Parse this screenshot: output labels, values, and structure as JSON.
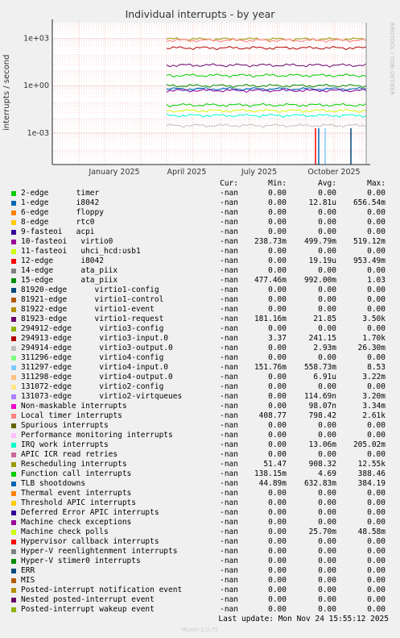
{
  "chart_data": {
    "type": "line",
    "title": "Individual interrupts - by year",
    "ylabel": "interrupts / second",
    "yscale": "log",
    "ytick_labels": [
      "1e+03",
      "1e+00",
      "1e-03"
    ],
    "xtick_labels": [
      "January 2025",
      "April 2025",
      "July 2025",
      "October 2025"
    ],
    "grid": true,
    "side_label": "RRDTOOL / TOBI OETIKER",
    "columns": [
      "Cur:",
      "Min:",
      "Avg:",
      "Max:"
    ],
    "series": [
      {
        "name": "2-edge      timer",
        "color": "#00cc00",
        "cur": "-nan",
        "min": "0.00",
        "avg": "0.00",
        "max": "0.00"
      },
      {
        "name": "1-edge      i8042",
        "color": "#0066b3",
        "cur": "-nan",
        "min": "0.00",
        "avg": "12.81u",
        "max": "656.54m"
      },
      {
        "name": "6-edge      floppy",
        "color": "#ff8000",
        "cur": "-nan",
        "min": "0.00",
        "avg": "0.00",
        "max": "0.00"
      },
      {
        "name": "8-edge      rtc0",
        "color": "#ffcc00",
        "cur": "-nan",
        "min": "0.00",
        "avg": "0.00",
        "max": "0.00"
      },
      {
        "name": "9-fasteoi   acpi",
        "color": "#330099",
        "cur": "-nan",
        "min": "0.00",
        "avg": "0.00",
        "max": "0.00"
      },
      {
        "name": "10-fasteoi   virtio0",
        "color": "#990099",
        "cur": "-nan",
        "min": "238.73m",
        "avg": "499.79m",
        "max": "519.12m"
      },
      {
        "name": "11-fasteoi   uhci_hcd:usb1",
        "color": "#ccff00",
        "cur": "-nan",
        "min": "0.00",
        "avg": "0.00",
        "max": "0.00"
      },
      {
        "name": "12-edge      i8042",
        "color": "#ff0000",
        "cur": "-nan",
        "min": "0.00",
        "avg": "19.19u",
        "max": "953.49m"
      },
      {
        "name": "14-edge      ata_piix",
        "color": "#808080",
        "cur": "-nan",
        "min": "0.00",
        "avg": "0.00",
        "max": "0.00"
      },
      {
        "name": "15-edge      ata_piix",
        "color": "#008f00",
        "cur": "-nan",
        "min": "477.46m",
        "avg": "992.00m",
        "max": "1.03"
      },
      {
        "name": "81920-edge      virtio1-config",
        "color": "#00487d",
        "cur": "-nan",
        "min": "0.00",
        "avg": "0.00",
        "max": "0.00"
      },
      {
        "name": "81921-edge      virtio1-control",
        "color": "#b35a00",
        "cur": "-nan",
        "min": "0.00",
        "avg": "0.00",
        "max": "0.00"
      },
      {
        "name": "81922-edge      virtio1-event",
        "color": "#b38f00",
        "cur": "-nan",
        "min": "0.00",
        "avg": "0.00",
        "max": "0.00"
      },
      {
        "name": "81923-edge      virtio1-request",
        "color": "#6b006b",
        "cur": "-nan",
        "min": "181.16m",
        "avg": "21.85",
        "max": "3.50k"
      },
      {
        "name": "294912-edge      virtio3-config",
        "color": "#8fb300",
        "cur": "-nan",
        "min": "0.00",
        "avg": "0.00",
        "max": "0.00"
      },
      {
        "name": "294913-edge      virtio3-input.0",
        "color": "#b30000",
        "cur": "-nan",
        "min": "3.37",
        "avg": "241.15",
        "max": "1.70k"
      },
      {
        "name": "294914-edge      virtio3-output.0",
        "color": "#bebebe",
        "cur": "-nan",
        "min": "0.00",
        "avg": "2.93m",
        "max": "26.30m"
      },
      {
        "name": "311296-edge      virtio4-config",
        "color": "#80ff80",
        "cur": "-nan",
        "min": "0.00",
        "avg": "0.00",
        "max": "0.00"
      },
      {
        "name": "311297-edge      virtio4-input.0",
        "color": "#80c9ff",
        "cur": "-nan",
        "min": "151.76m",
        "avg": "558.73m",
        "max": "8.53"
      },
      {
        "name": "311298-edge      virtio4-output.0",
        "color": "#ffc080",
        "cur": "-nan",
        "min": "0.00",
        "avg": "6.91u",
        "max": "3.22m"
      },
      {
        "name": "131072-edge      virtio2-config",
        "color": "#ffe680",
        "cur": "-nan",
        "min": "0.00",
        "avg": "0.00",
        "max": "0.00"
      },
      {
        "name": "131073-edge      virtio2-virtqueues",
        "color": "#aa80ff",
        "cur": "-nan",
        "min": "0.00",
        "avg": "114.69n",
        "max": "3.20m"
      },
      {
        "name": "Non-maskable interrupts",
        "color": "#ee00cc",
        "cur": "-nan",
        "min": "0.00",
        "avg": "98.07n",
        "max": "3.34m"
      },
      {
        "name": "Local timer interrupts",
        "color": "#ff8080",
        "cur": "-nan",
        "min": "408.77",
        "avg": "798.42",
        "max": "2.61k"
      },
      {
        "name": "Spurious interrupts",
        "color": "#666600",
        "cur": "-nan",
        "min": "0.00",
        "avg": "0.00",
        "max": "0.00"
      },
      {
        "name": "Performance monitoring interrupts",
        "color": "#ffbfff",
        "cur": "-nan",
        "min": "0.00",
        "avg": "0.00",
        "max": "0.00"
      },
      {
        "name": "IRQ work interrupts",
        "color": "#00ffcc",
        "cur": "-nan",
        "min": "0.00",
        "avg": "13.06m",
        "max": "205.02m"
      },
      {
        "name": "APIC ICR read retries",
        "color": "#cc6699",
        "cur": "-nan",
        "min": "0.00",
        "avg": "0.00",
        "max": "0.00"
      },
      {
        "name": "Rescheduling interrupts",
        "color": "#999900",
        "cur": "-nan",
        "min": "51.47",
        "avg": "908.32",
        "max": "12.55k"
      },
      {
        "name": "Function call interrupts",
        "color": "#00cc00",
        "cur": "-nan",
        "min": "138.15m",
        "avg": "4.69",
        "max": "388.46"
      },
      {
        "name": "TLB shootdowns",
        "color": "#0066b3",
        "cur": "-nan",
        "min": "44.89m",
        "avg": "632.83m",
        "max": "384.19"
      },
      {
        "name": "Thermal event interrupts",
        "color": "#ff8000",
        "cur": "-nan",
        "min": "0.00",
        "avg": "0.00",
        "max": "0.00"
      },
      {
        "name": "Threshold APIC interrupts",
        "color": "#ffcc00",
        "cur": "-nan",
        "min": "0.00",
        "avg": "0.00",
        "max": "0.00"
      },
      {
        "name": "Deferred Error APIC interrupts",
        "color": "#330099",
        "cur": "-nan",
        "min": "0.00",
        "avg": "0.00",
        "max": "0.00"
      },
      {
        "name": "Machine check exceptions",
        "color": "#990099",
        "cur": "-nan",
        "min": "0.00",
        "avg": "0.00",
        "max": "0.00"
      },
      {
        "name": "Machine check polls",
        "color": "#ccff00",
        "cur": "-nan",
        "min": "0.00",
        "avg": "25.70m",
        "max": "48.58m"
      },
      {
        "name": "Hypervisor callback interrupts",
        "color": "#ff0000",
        "cur": "-nan",
        "min": "0.00",
        "avg": "0.00",
        "max": "0.00"
      },
      {
        "name": "Hyper-V reenlightenment interrupts",
        "color": "#808080",
        "cur": "-nan",
        "min": "0.00",
        "avg": "0.00",
        "max": "0.00"
      },
      {
        "name": "Hyper-V stimer0 interrupts",
        "color": "#008f00",
        "cur": "-nan",
        "min": "0.00",
        "avg": "0.00",
        "max": "0.00"
      },
      {
        "name": "ERR",
        "color": "#00487d",
        "cur": "-nan",
        "min": "0.00",
        "avg": "0.00",
        "max": "0.00"
      },
      {
        "name": "MIS",
        "color": "#b35a00",
        "cur": "-nan",
        "min": "0.00",
        "avg": "0.00",
        "max": "0.00"
      },
      {
        "name": "Posted-interrupt notification event",
        "color": "#b38f00",
        "cur": "-nan",
        "min": "0.00",
        "avg": "0.00",
        "max": "0.00"
      },
      {
        "name": "Nested posted-interrupt event",
        "color": "#6b006b",
        "cur": "-nan",
        "min": "0.00",
        "avg": "0.00",
        "max": "0.00"
      },
      {
        "name": "Posted-interrupt wakeup event",
        "color": "#8fb300",
        "cur": "-nan",
        "min": "0.00",
        "avg": "0.00",
        "max": "0.00"
      }
    ],
    "plot_lines": [
      {
        "color": "#999900",
        "value": 900
      },
      {
        "color": "#b30000",
        "value": 250
      },
      {
        "color": "#ff8080",
        "value": 750
      },
      {
        "color": "#6b006b",
        "value": 20
      },
      {
        "color": "#00cc00",
        "value": 4.5
      },
      {
        "color": "#008f00",
        "value": 1.0
      },
      {
        "color": "#80c9ff",
        "value": 0.56
      },
      {
        "color": "#0066b3",
        "value": 0.63
      },
      {
        "color": "#990099",
        "value": 0.5
      },
      {
        "color": "#00cc00",
        "value": 0.06
      },
      {
        "color": "#ccff00",
        "value": 0.026
      },
      {
        "color": "#00ffcc",
        "value": 0.013
      },
      {
        "color": "#bebebe",
        "value": 0.003
      }
    ]
  },
  "footer": {
    "last_update": "Last update: Mon Nov 24 15:55:12 2025",
    "munin": "Munin 2.0.75"
  }
}
